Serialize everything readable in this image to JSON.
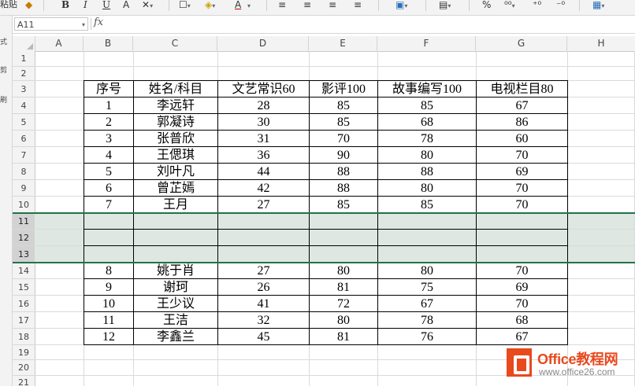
{
  "ribbon": {
    "paste_label": "粘贴",
    "bold": "B",
    "italic": "I",
    "underline": "U",
    "font_color_glyph": "A",
    "percent": "%",
    "accent_font_color": "#c00000"
  },
  "left_strip": [
    "式",
    "剪",
    "刷"
  ],
  "formula_bar": {
    "name_box": "A11",
    "fx": "fx",
    "value": ""
  },
  "columns": [
    "A",
    "B",
    "C",
    "D",
    "E",
    "F",
    "G",
    "H"
  ],
  "rows": [
    "1",
    "2",
    "3",
    "4",
    "5",
    "6",
    "7",
    "8",
    "9",
    "10",
    "11",
    "12",
    "13",
    "14",
    "15",
    "16",
    "17",
    "18",
    "19",
    "20",
    "21"
  ],
  "selected_rows": [
    "11",
    "12",
    "13"
  ],
  "table": {
    "headers": [
      "序号",
      "姓名/科目",
      "文艺常识60",
      "影评100",
      "故事编写100",
      "电视栏目80"
    ],
    "rows": [
      [
        "1",
        "李远轩",
        "28",
        "85",
        "85",
        "67"
      ],
      [
        "2",
        "郭凝诗",
        "30",
        "85",
        "68",
        "86"
      ],
      [
        "3",
        "张普欣",
        "31",
        "70",
        "78",
        "60"
      ],
      [
        "4",
        "王偲琪",
        "36",
        "90",
        "80",
        "70"
      ],
      [
        "5",
        "刘叶凡",
        "44",
        "88",
        "88",
        "69"
      ],
      [
        "6",
        "曾芷嫣",
        "42",
        "88",
        "80",
        "70"
      ],
      [
        "7",
        "王月",
        "27",
        "85",
        "85",
        "70"
      ],
      [
        "",
        "",
        "",
        "",
        "",
        ""
      ],
      [
        "",
        "",
        "",
        "",
        "",
        ""
      ],
      [
        "",
        "",
        "",
        "",
        "",
        ""
      ],
      [
        "8",
        "姚于肖",
        "27",
        "80",
        "80",
        "70"
      ],
      [
        "9",
        "谢珂",
        "26",
        "81",
        "75",
        "69"
      ],
      [
        "10",
        "王少议",
        "41",
        "72",
        "67",
        "70"
      ],
      [
        "11",
        "王洁",
        "32",
        "80",
        "78",
        "68"
      ],
      [
        "12",
        "李鑫兰",
        "45",
        "81",
        "76",
        "67"
      ]
    ]
  },
  "watermark": {
    "brand": "Office教程网",
    "url": "www.office26.com"
  },
  "selection_color": "#217346"
}
